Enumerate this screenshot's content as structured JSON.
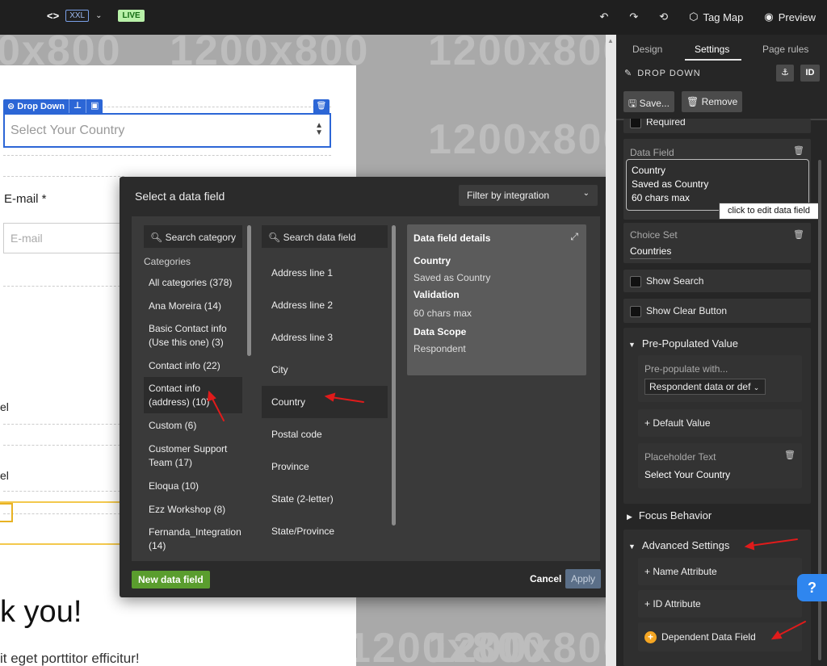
{
  "topbar": {
    "code_glyph": "<>",
    "breakpoint": "XXL",
    "live": "LIVE",
    "tag_map": "Tag Map",
    "preview": "Preview"
  },
  "canvas": {
    "watermark": "1200x800",
    "watermark_left": "0x800",
    "dropdown_label": "Drop Down",
    "dropdown_placeholder": "Select Your Country",
    "email_label": "E-mail *",
    "email_placeholder": "E-mail",
    "frag_el_1": "el",
    "frag_el_2": "el",
    "thanks": "k you!",
    "lorem": "it eget porttitor efficitur!"
  },
  "modal": {
    "title": "Select a data field",
    "filter": "Filter by integration",
    "search_category": "Search category",
    "search_field": "Search data field",
    "categories_heading": "Categories",
    "categories": [
      "All categories (378)",
      "Ana Moreira (14)",
      "Basic Contact info (Use this one) (3)",
      "Contact info (22)",
      "Contact info (address) (10)",
      "Custom (6)",
      "Customer Support Team (17)",
      "Eloqua (10)",
      "Ezz Workshop (8)",
      "Fernanda_Integration (14)"
    ],
    "fields": [
      "Address line 1",
      "Address line 2",
      "Address line 3",
      "City",
      "Country",
      "Postal code",
      "Province",
      "State (2-letter)",
      "State/Province"
    ],
    "details": {
      "heading": "Data field details",
      "name": "Country",
      "saved_as": "Saved as Country",
      "validation_label": "Validation",
      "validation_value": "60 chars max",
      "scope_label": "Data Scope",
      "scope_value": "Respondent"
    },
    "new_field": "New data field",
    "cancel": "Cancel",
    "apply": "Apply"
  },
  "panel": {
    "tabs": [
      "Design",
      "Settings",
      "Page rules"
    ],
    "element_name": "DROP DOWN",
    "id_badge": "ID",
    "save_btn": "Save...",
    "remove_btn": "Remove",
    "required": "Required",
    "data_field_title": "Data Field",
    "data_field_name": "Country",
    "data_field_saved": "Saved as Country",
    "data_field_max": "60 chars max",
    "tooltip": "click to edit data field",
    "choice_set_title": "Choice Set",
    "choice_set_value": "Countries",
    "show_search": "Show Search",
    "show_clear": "Show Clear Button",
    "prepop_title": "Pre-Populated Value",
    "prepop_with": "Pre-populate with...",
    "prepop_select": "Respondent data or def",
    "default_value": "+ Default Value",
    "placeholder_title": "Placeholder Text",
    "placeholder_value": "Select Your Country",
    "focus_behavior": "Focus Behavior",
    "advanced": "Advanced Settings",
    "name_attr": "+ Name Attribute",
    "id_attr": "+ ID Attribute",
    "dependent": "Dependent Data Field",
    "help": "?"
  },
  "colors": {
    "selection_blue": "#2c66d6",
    "live_green": "#b8f0a8",
    "new_field_green": "#5a9d2e",
    "annotation_red": "#e01b1b",
    "help_blue": "#2f86ef"
  }
}
